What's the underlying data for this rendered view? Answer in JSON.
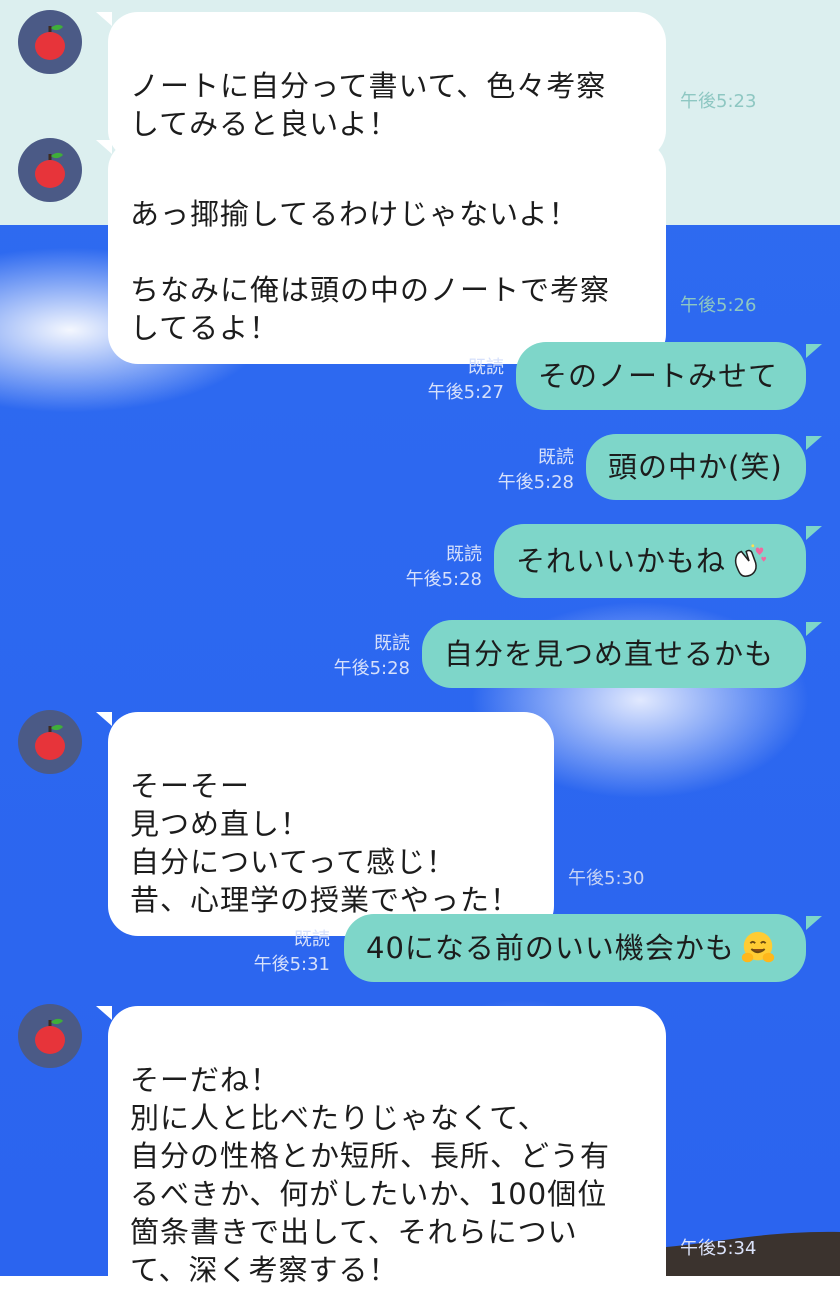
{
  "messages": [
    {
      "side": "in",
      "avatar_icon": "apple-icon",
      "text": "ノートに自分って書いて、色々考察\nしてみると良いよ！",
      "time": "午後5:23"
    },
    {
      "side": "in",
      "avatar_icon": "apple-icon",
      "text": "あっ揶揄してるわけじゃないよ！\n\nちなみに俺は頭の中のノートで考察\nしてるよ！",
      "time": "午後5:26"
    },
    {
      "side": "out",
      "text": "そのノートみせて",
      "read": "既読",
      "time": "午後5:27"
    },
    {
      "side": "out",
      "text": "頭の中か(笑)",
      "read": "既読",
      "time": "午後5:28"
    },
    {
      "side": "out",
      "text": "それいいかもね",
      "emoji": "clapping-hands-sticker-icon",
      "read": "既読",
      "time": "午後5:28"
    },
    {
      "side": "out",
      "text": "自分を見つめ直せるかも",
      "read": "既読",
      "time": "午後5:28"
    },
    {
      "side": "in",
      "avatar_icon": "apple-icon",
      "text": "そーそー\n見つめ直し！\n自分についてって感じ！\n昔、心理学の授業でやった！",
      "time": "午後5:30"
    },
    {
      "side": "out",
      "text": "40になる前のいい機会かも",
      "emoji": "hugging-face-icon",
      "read": "既読",
      "time": "午後5:31"
    },
    {
      "side": "in",
      "avatar_icon": "apple-icon",
      "text": "そーだね！\n別に人と比べたりじゃなくて、\n自分の性格とか短所、長所、どう有\nるべきか、何がしたいか、100個位\n箇条書きで出して、それらについ\nて、深く考察する！",
      "time": "午後5:34"
    }
  ],
  "colors": {
    "chat_background": "#2b64ef",
    "top_band": "#dcefef",
    "incoming_bubble": "#ffffff",
    "outgoing_bubble": "#7ed6c9",
    "avatar_background": "#4b5a86"
  }
}
